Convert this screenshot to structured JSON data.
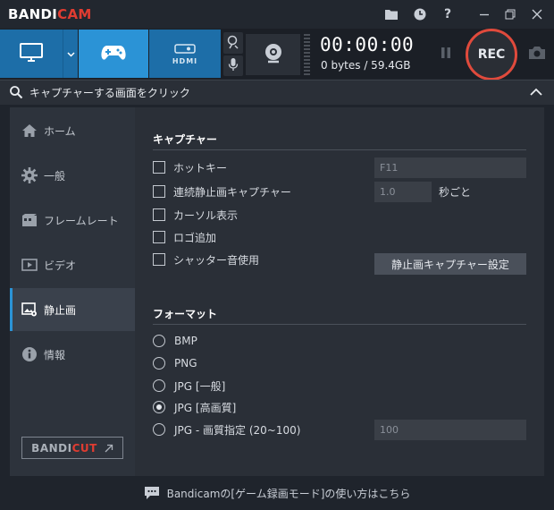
{
  "app": {
    "logo_part1": "BANDI",
    "logo_part2": "CAM",
    "brand_color": "#e03c31",
    "accent_color": "#2b93d6"
  },
  "titlebar": {
    "icons": [
      "folder-icon",
      "clock-icon",
      "help-icon",
      "minimize-icon",
      "restore-icon",
      "close-icon"
    ],
    "help_text": "?"
  },
  "toolbar": {
    "modes": [
      "screen-mode",
      "game-mode",
      "hdmi-mode"
    ],
    "hdmi_label": "HDMI",
    "timer": "00:00:00",
    "filesize": "0 bytes / 59.4GB",
    "rec_label": "REC"
  },
  "capture_bar": {
    "text": "キャプチャーする画面をクリック"
  },
  "sidebar": {
    "items": [
      {
        "label": "ホーム",
        "icon": "home-icon"
      },
      {
        "label": "一般",
        "icon": "gear-icon"
      },
      {
        "label": "フレームレート",
        "icon": "film-icon"
      },
      {
        "label": "ビデオ",
        "icon": "video-icon"
      },
      {
        "label": "静止画",
        "icon": "image-icon",
        "active": true
      },
      {
        "label": "情報",
        "icon": "info-icon"
      }
    ],
    "bandicut_part1": "BANDI",
    "bandicut_part2": "CUT"
  },
  "capture": {
    "title": "キャプチャー",
    "hotkey_label": "ホットキー",
    "hotkey_value": "F11",
    "continuous_label": "連続静止画キャプチャー",
    "interval_value": "1.0",
    "interval_unit": "秒ごと",
    "cursor_label": "カーソル表示",
    "logo_label": "ロゴ追加",
    "shutter_label": "シャッター音使用",
    "settings_button": "静止画キャプチャー設定"
  },
  "format": {
    "title": "フォーマット",
    "options": [
      "BMP",
      "PNG",
      "JPG [一般]",
      "JPG [高画質]",
      "JPG - 画質指定 (20~100)"
    ],
    "selected": "JPG [高画質]",
    "quality_value": "100"
  },
  "footer": {
    "text": "Bandicamの[ゲーム録画モード]の使い方はこちら"
  }
}
